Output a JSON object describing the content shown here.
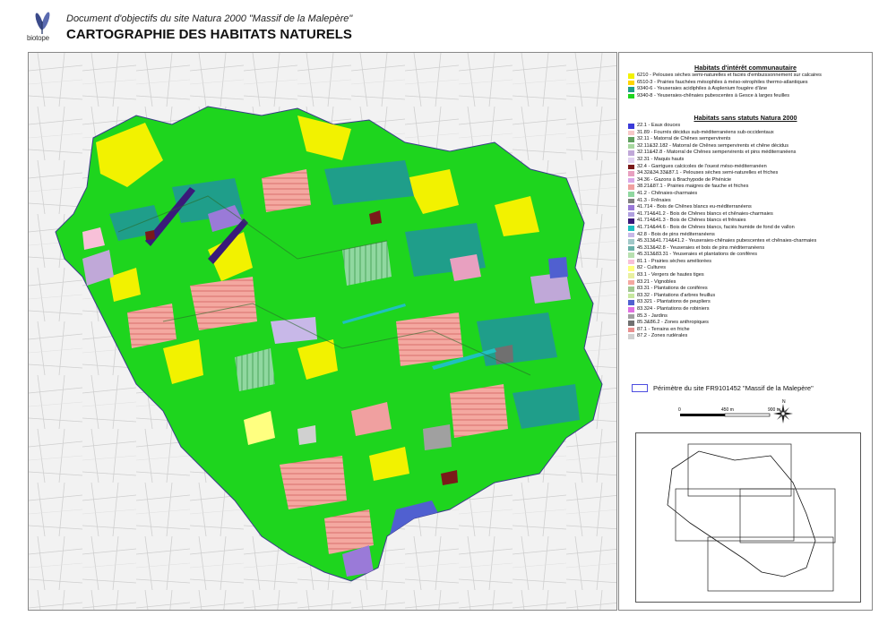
{
  "header": {
    "logo_text": "biotope",
    "doc_title": "Document d'objectifs du site Natura 2000 \"Massif de la Malepère\"",
    "page_title": "CARTOGRAPHIE DES HABITATS NATURELS"
  },
  "legend": {
    "section1_title": "Habitats d'intérêt communautaire",
    "section1_items": [
      {
        "label": "6210 - Pelouses sèches semi-naturelles et faciès d'embuissonnement sur calcaires",
        "color": "#f2f200"
      },
      {
        "label": "6510-3 - Prairies fauchées mésophiles à méso-xérophiles thermo-atlantiques",
        "color": "#ffd400"
      },
      {
        "label": "9340-6 - Yeuseraies acidiphiles à Asplenium fougère d'âne",
        "color": "#1f9e8a"
      },
      {
        "label": "9340-8 - Yeuseraies-chênaies pubescentes à Gesce à larges feuilles",
        "color": "#1ed51e"
      }
    ],
    "section2_title": "Habitats sans statuts Natura 2000",
    "section2_items": [
      {
        "label": "22.1 - Eaux douces",
        "color": "#3b3bd9"
      },
      {
        "label": "31.89 - Fourrés décidus sub-méditerranéens sub-occidentaux",
        "color": "#f7c8c8"
      },
      {
        "label": "32.11 - Matorral de Chênes sempervirents",
        "color": "#5fa05f"
      },
      {
        "label": "32.11&32.182 - Matorral de Chênes sempervirents et chêne décidus",
        "color": "#a8d8a0"
      },
      {
        "label": "32.11&42.8 - Matorral de Chênes sempervirents et pins méditerranéens",
        "color": "#c0a8d8"
      },
      {
        "label": "32.31 - Maquis hauts",
        "color": "#e0d0f0"
      },
      {
        "label": "32.4 - Garrigues calcicoles de l'ouest méso-méditerranéen",
        "color": "#7a1a1a"
      },
      {
        "label": "34.32&34.33&87.1 - Pelouses sèches semi-naturelles et friches",
        "color": "#e8a0c0"
      },
      {
        "label": "34.36 - Gazons à Brachypode de Phénicie",
        "color": "#d8a8e8"
      },
      {
        "label": "38.21&87.1 - Prairies maigres de fauche et friches",
        "color": "#f0a0a0"
      },
      {
        "label": "41.2 - Chênaies-charmaies",
        "color": "#90d8a0"
      },
      {
        "label": "41.3 - Frênaies",
        "color": "#7f7f7f"
      },
      {
        "label": "41.714 - Bois de Chênes blancs eu-méditerranéens",
        "color": "#9a7ad8"
      },
      {
        "label": "41.714&41.2 - Bois de Chênes blancs et chênaies-charmaies",
        "color": "#b0a0e0"
      },
      {
        "label": "41.714&41.3 - Bois de Chênes blancs et frênaies",
        "color": "#3a1a7a"
      },
      {
        "label": "41.714&44.6 - Bois de Chênes blancs, faciès humide de fond de vallon",
        "color": "#20c0c0"
      },
      {
        "label": "42.8 - Bois de pins méditerranéens",
        "color": "#c8b8e8"
      },
      {
        "label": "45.313&41.714&41.2 - Yeuseraies-chênaies pubescentes et chênaies-charmaies",
        "color": "#a0c8c8"
      },
      {
        "label": "45.313&42.8 - Yeuseraies et bois de pins méditerranéens",
        "color": "#6ab0a8"
      },
      {
        "label": "45.313&83.31 - Yeuseraies et plantations de conifères",
        "color": "#b8e0b0"
      },
      {
        "label": "81.1 - Prairies sèches améliorées",
        "color": "#f8c0d8"
      },
      {
        "label": "82 - Cultures",
        "color": "#ffff80"
      },
      {
        "label": "83.1 - Vergers de hautes tiges",
        "color": "#e8f0a0"
      },
      {
        "label": "83.21 - Vignobles",
        "color": "#f4a8a0"
      },
      {
        "label": "83.31 - Plantations de conifères",
        "color": "#a0c890"
      },
      {
        "label": "83.32 - Plantations d'arbres feuillus",
        "color": "#c8e8a0"
      },
      {
        "label": "83.321 - Plantations de peupliers",
        "color": "#5060d0"
      },
      {
        "label": "83.324 - Plantations de robiniers",
        "color": "#e070e0"
      },
      {
        "label": "85.3 - Jardins",
        "color": "#a0a0a0"
      },
      {
        "label": "85.3&86.2 - Zones anthropiques",
        "color": "#707070"
      },
      {
        "label": "87.1 - Terrains en friche",
        "color": "#e89090"
      },
      {
        "label": "87.2 - Zones rudérales",
        "color": "#d0d0d0"
      }
    ],
    "perimeter_label": "Périmètre du site FR9101452 \"Massif de la Malepère\"",
    "perimeter_color": "#4e4ee0",
    "scale_labels": [
      "0",
      "450 m",
      "900 m"
    ],
    "north_label": "N"
  },
  "map": {
    "habitat_colors": [
      "#1ed51e",
      "#1ed51e",
      "#f2f200",
      "#1f9e8a",
      "#f4a8a0",
      "#c0a8d8",
      "#9a7ad8",
      "#a0a0a0",
      "#5060d0",
      "#7a1a1a"
    ]
  }
}
